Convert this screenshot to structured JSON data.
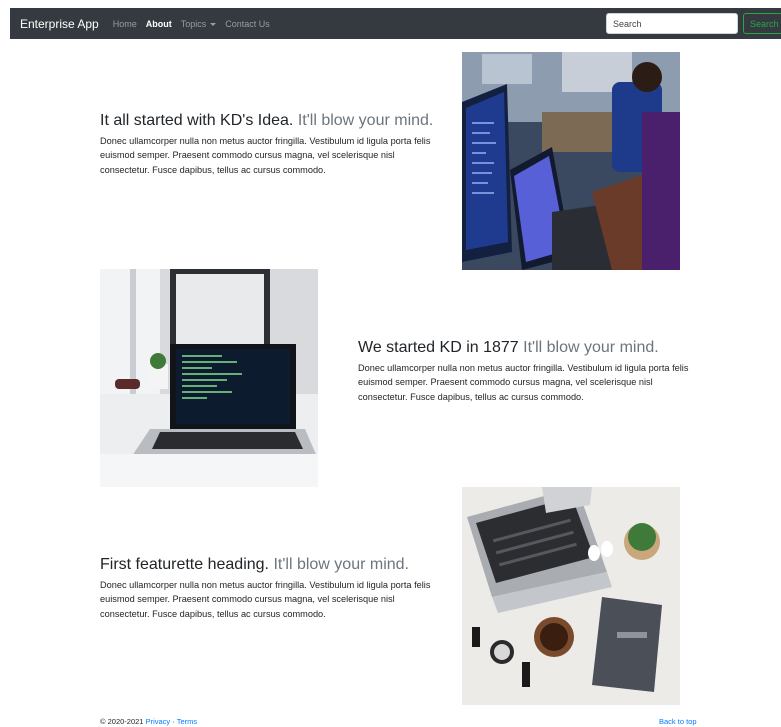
{
  "navbar": {
    "brand": "Enterprise App",
    "links": [
      "Home",
      "About",
      "Topics",
      "Contact Us"
    ],
    "search_placeholder": "Search",
    "search_button": "Search"
  },
  "featurettes": [
    {
      "heading": "It all started with KD's Idea.",
      "muted": "It'll blow your mind.",
      "body": "Donec ullamcorper nulla non metus auctor fringilla. Vestibulum id ligula porta felis euismod semper. Praesent commodo cursus magna, vel scelerisque nisl consectetur. Fusce dapibus, tellus ac cursus commodo."
    },
    {
      "heading": "We started KD in 1877",
      "muted": "It'll blow your mind.",
      "body": "Donec ullamcorper nulla non metus auctor fringilla. Vestibulum id ligula porta felis euismod semper. Praesent commodo cursus magna, vel scelerisque nisl consectetur. Fusce dapibus, tellus ac cursus commodo."
    },
    {
      "heading": "First featurette heading.",
      "muted": "It'll blow your mind.",
      "body": "Donec ullamcorper nulla non metus auctor fringilla. Vestibulum id ligula porta felis euismod semper. Praesent commodo cursus magna, vel scelerisque nisl consectetur. Fusce dapibus, tellus ac cursus commodo."
    }
  ],
  "footer": {
    "copyright": "© 2020-2021",
    "privacy": "Privacy",
    "separator": "·",
    "terms": "Terms",
    "back_to_top": "Back to top"
  }
}
